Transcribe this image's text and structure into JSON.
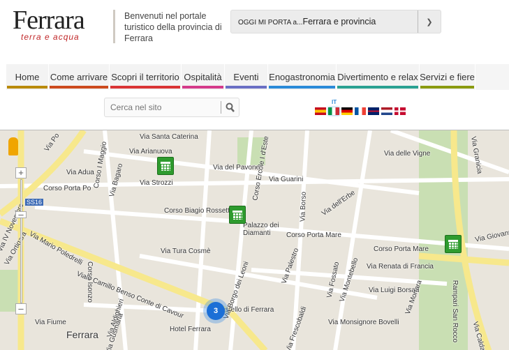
{
  "header": {
    "logo_title": "Ferrara",
    "logo_subtitle": "terra e acqua",
    "welcome": "Benvenuti nel portale turistico della provincia di Ferrara",
    "select_prefix": "OGGI MI PORTA a...",
    "select_value": "Ferrara e provincia"
  },
  "nav": [
    {
      "label": "Home",
      "color": "#b98a0a"
    },
    {
      "label": "Come arrivare",
      "color": "#cc4a1e"
    },
    {
      "label": "Scopri il territorio",
      "color": "#d93435"
    },
    {
      "label": "Ospitalità",
      "color": "#d43a8a"
    },
    {
      "label": "Eventi",
      "color": "#6a6fc4"
    },
    {
      "label": "Enogastronomia",
      "color": "#2a8ad8"
    },
    {
      "label": "Divertimento e relax",
      "color": "#2aa192"
    },
    {
      "label": "Servizi e fiere",
      "color": "#8a9a10"
    }
  ],
  "search": {
    "placeholder": "Cerca nel sito"
  },
  "language": {
    "current": "IT",
    "flags": [
      "es",
      "it",
      "de",
      "fr",
      "gb",
      "nl",
      "dk"
    ]
  },
  "map": {
    "cluster_count": "3",
    "streets": [
      "Via Santa Caterina",
      "Via Arianuova",
      "Corso Ercole I d'Este",
      "Via delle Vigne",
      "Via Granicia",
      "Via Po",
      "Via Adua",
      "Corso I Maggio",
      "Via Bagaro",
      "Via Strozzi",
      "Via del Pavone",
      "Via Arianuova",
      "Via Guarini",
      "Via Giovanni",
      "SS16",
      "Corso Porta Po",
      "Corso Biagio Rossetti",
      "Palazzo dei Diamanti",
      "Via Borso",
      "Via dell'Erbe",
      "Via delle Vigne",
      "Corso Porta Mare",
      "Corso Porta Mare",
      "Viale Camillo Benso Conte di Cavour",
      "Via Mario Poledrelli",
      "Via Tura Cosmè",
      "Via Borgo dei Leoni",
      "Via Palestro",
      "Via Fossato",
      "Via Montebello",
      "Via Renata di Francia",
      "Via Luigi Borsari",
      "Via Mortara",
      "Rampari San Rocco",
      "Corso Isonzo",
      "Via Aldighieri",
      "Via Gusmaria",
      "Via Fiume",
      "Via Ortigara",
      "Via IV Novembre",
      "Castello di Ferrara",
      "Hotel Ferrara",
      "Ferrara",
      "Via Monsignore Bovelli",
      "Via Frescobaldi",
      "Via Calda"
    ]
  }
}
